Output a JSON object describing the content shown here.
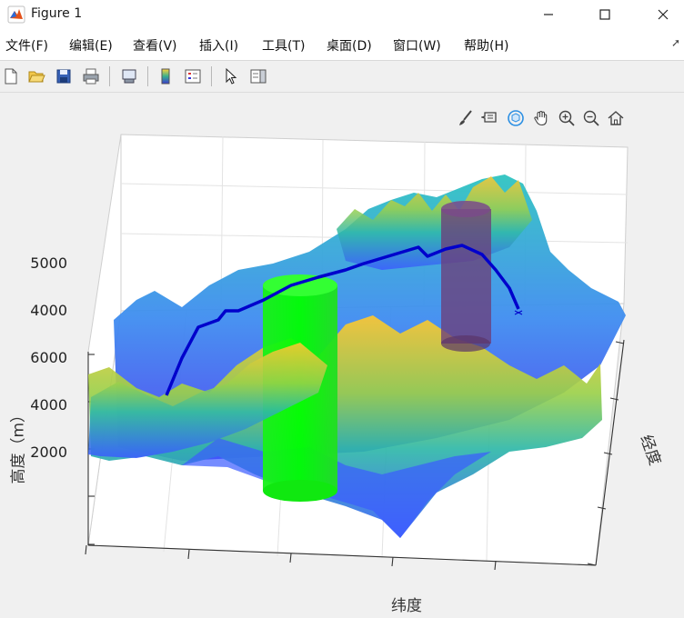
{
  "window": {
    "title": "Figure 1",
    "minimize_icon": "minimize-icon",
    "maximize_icon": "maximize-icon",
    "close_icon": "close-icon"
  },
  "menu": [
    {
      "label": "文件(F)"
    },
    {
      "label": "编辑(E)"
    },
    {
      "label": "查看(V)"
    },
    {
      "label": "插入(I)"
    },
    {
      "label": "工具(T)"
    },
    {
      "label": "桌面(D)"
    },
    {
      "label": "窗口(W)"
    },
    {
      "label": "帮助(H)"
    }
  ],
  "toolbar": {
    "buttons": [
      "new-figure-icon",
      "open-file-icon",
      "save-icon",
      "print-icon",
      "link-plot-icon",
      "insert-colorbar-icon",
      "insert-legend-icon",
      "edit-plot-arrow-icon",
      "show-property-inspector-icon"
    ]
  },
  "axes_toolbar": {
    "buttons": [
      "brush-icon",
      "data-tips-icon",
      "rotate-3d-icon",
      "pan-hand-icon",
      "zoom-in-icon",
      "zoom-out-icon",
      "home-restore-icon"
    ]
  },
  "plot": {
    "z_ticks": [
      "5000",
      "4000",
      "6000",
      "4000",
      "2000"
    ],
    "z_label": "高度（m）",
    "x_label": "纬度",
    "y_label": "经度",
    "colors": {
      "path": "#0000cc",
      "green_cylinder": "#00ff00",
      "purple_cylinder": "#6b3f7a",
      "surface_low": "#3b5bff",
      "surface_high": "#ffc730"
    }
  }
}
